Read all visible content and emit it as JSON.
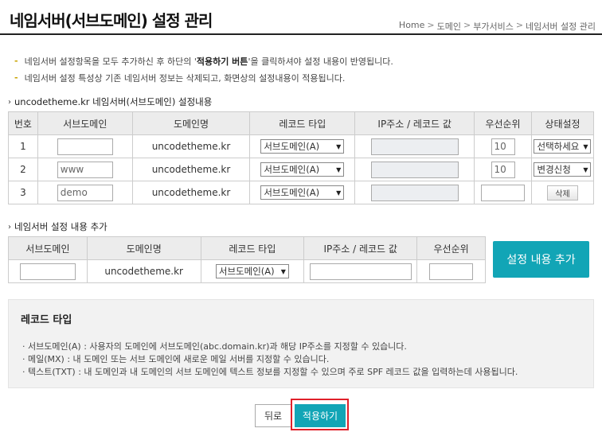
{
  "header": {
    "title": "네임서버(서브도메인) 설정 관리",
    "breadcrumb": [
      "Home",
      "도메인",
      "부가서비스",
      "네임서버 설정 관리"
    ]
  },
  "notes": [
    {
      "pre": "네임서버 설정항목을 모두 추가하신 후 하단의 '",
      "bold": "적용하기 버튼",
      "post": "'을 클릭하셔야 설정 내용이 반영됩니다."
    },
    {
      "pre": "네임서버 설정 특성상 기존 네임서버 정보는 삭제되고, 화면상의 설정내용이 적용됩니다.",
      "bold": "",
      "post": ""
    }
  ],
  "current": {
    "title": "uncodetheme.kr 네임서버(서브도메인) 설정내용",
    "headers": [
      "번호",
      "서브도메인",
      "도메인명",
      "레코드 타입",
      "IP주소 / 레코드 값",
      "우선순위",
      "상태설정"
    ],
    "rows": [
      {
        "no": "1",
        "sub": "",
        "domain": "uncodetheme.kr",
        "record": "서브도메인(A)",
        "ip": "",
        "priority": "10",
        "status": "선택하세요",
        "status_type": "select"
      },
      {
        "no": "2",
        "sub": "www",
        "domain": "uncodetheme.kr",
        "record": "서브도메인(A)",
        "ip": "",
        "priority": "10",
        "status": "변경신청",
        "status_type": "select"
      },
      {
        "no": "3",
        "sub": "demo",
        "domain": "uncodetheme.kr",
        "record": "서브도메인(A)",
        "ip": "",
        "priority": "",
        "status": "삭제",
        "status_type": "button"
      }
    ]
  },
  "add": {
    "title": "네임서버 설정 내용 추가",
    "headers": [
      "서브도메인",
      "도메인명",
      "레코드 타입",
      "IP주소 / 레코드 값",
      "우선순위"
    ],
    "row": {
      "sub": "",
      "domain": "uncodetheme.kr",
      "record": "서브도메인(A)",
      "ip": "",
      "priority": ""
    },
    "button": "설정 내용 추가"
  },
  "record_types": {
    "title": "레코드 타입",
    "items": [
      "· 서브도메인(A) : 사용자의 도메인에 서브도메인(abc.domain.kr)과 해당 IP주소를 지정할 수 있습니다.",
      "· 메일(MX) : 내 도메인 또는 서브 도메인에 새로운 메일 서버를 지정할 수 있습니다.",
      "· 텍스트(TXT) : 내 도메인과 내 도메인의 서브 도메인에 텍스트 정보를 지정할 수 있으며 주로 SPF 레코드 값을 입력하는데 사용됩니다."
    ]
  },
  "footer": {
    "back": "뒤로",
    "apply": "적용하기"
  },
  "colors": {
    "accent": "#12a5b6",
    "highlight": "#e0202a",
    "bullet": "#c8a300"
  }
}
